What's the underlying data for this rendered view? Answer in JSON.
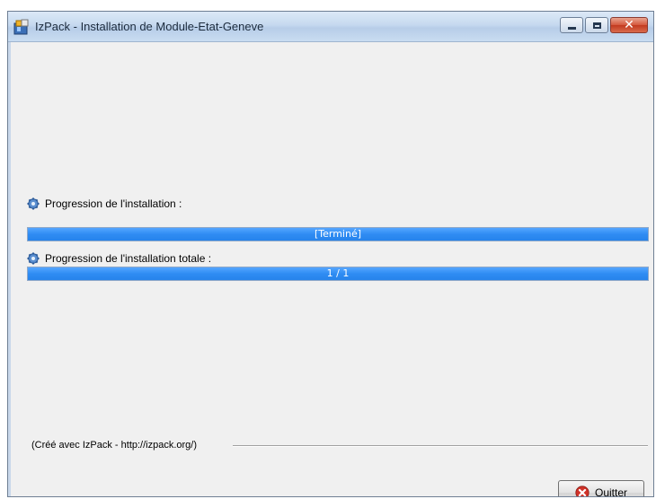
{
  "window": {
    "title": "IzPack - Installation de Module-Etat-Geneve",
    "controls": {
      "minimize_icon": "minimize-icon",
      "maximize_icon": "maximize-icon",
      "close_icon": "close-icon",
      "close_glyph": "✕"
    }
  },
  "progress": {
    "current_label": "Progression de l'installation :",
    "current_text": "[Terminé]",
    "current_value": 1.0,
    "total_label": "Progression de l'installation totale :",
    "total_text": "1 / 1",
    "total_value": 1.0
  },
  "footer": {
    "credit": "(Créé avec IzPack - http://izpack.org/)"
  },
  "buttons": {
    "quit_label": "Quitter"
  },
  "colors": {
    "progress_fill": "#2f8cf3",
    "quit_icon": "#d0332a"
  }
}
